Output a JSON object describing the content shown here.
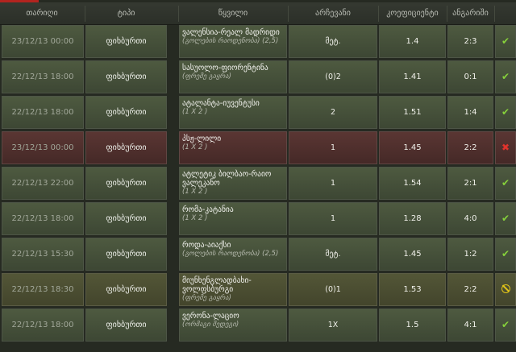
{
  "headers": [
    "თარიღი",
    "ტიპი",
    "წყვილი",
    "არჩევანი",
    "კოეფიციენტი",
    "ანგარიში"
  ],
  "rows": [
    {
      "date": "23/12/13 00:00",
      "type": "ფიხბურთი",
      "match": "ვალენსია-რეალ მადრიდი",
      "market": "(გოლების რაოდენობა) (2,5)",
      "choice": "მეტ.",
      "odds": "1.4",
      "score": "2:3",
      "status": "win"
    },
    {
      "date": "22/12/13 18:00",
      "type": "ფიხბურთი",
      "match": "სასუოლო-ფიორენტინა",
      "market": "(ფრემე გაყრა)",
      "choice": "(0)2",
      "odds": "1.41",
      "score": "0:1",
      "status": "win"
    },
    {
      "date": "22/12/13 18:00",
      "type": "ფიხბურთი",
      "match": "ატალანტა-იუვენტუსი",
      "market": "(1 X 2 )",
      "choice": "2",
      "odds": "1.51",
      "score": "1:4",
      "status": "win"
    },
    {
      "date": "23/12/13 00:00",
      "type": "ფიხბურთი",
      "match": "პსჟ-ლილი",
      "market": "(1 X 2 )",
      "choice": "1",
      "odds": "1.45",
      "score": "2:2",
      "status": "lose"
    },
    {
      "date": "22/12/13 22:00",
      "type": "ფიხბურთი",
      "match": "ატლეტიკ ბილბაო-რაიო ვალეკანო",
      "market": "(1 X 2 )",
      "choice": "1",
      "odds": "1.54",
      "score": "2:1",
      "status": "win"
    },
    {
      "date": "22/12/13 18:00",
      "type": "ფიხბურთი",
      "match": "რომა-კატანია",
      "market": "(1 X 2 )",
      "choice": "1",
      "odds": "1.28",
      "score": "4:0",
      "status": "win"
    },
    {
      "date": "22/12/13 15:30",
      "type": "ფიხბურთი",
      "match": "როდა-აიაქსი",
      "market": "(გოლების რაოდენობა) (2,5)",
      "choice": "მეტ.",
      "odds": "1.45",
      "score": "1:2",
      "status": "win"
    },
    {
      "date": "22/12/13 18:30",
      "type": "ფიხბურთი",
      "match": "მიუნხენგლადბახი-ვოლფსბურგი",
      "market": "(ფრემე გაყრა)",
      "choice": "(0)1",
      "odds": "1.53",
      "score": "2:2",
      "status": "pending"
    },
    {
      "date": "22/12/13 18:00",
      "type": "ფიხბურთი",
      "match": "ვერონა-ლაციო",
      "market": "(ორმაგი შედეგი)",
      "choice": "1X",
      "odds": "1.5",
      "score": "4:1",
      "status": "win"
    }
  ],
  "icons": {
    "win": "check-icon",
    "lose": "x-icon",
    "pending": "pending-icon"
  },
  "colors": {
    "win": "#86d13b",
    "lose": "#e0332c",
    "pending": "#e2c418"
  }
}
